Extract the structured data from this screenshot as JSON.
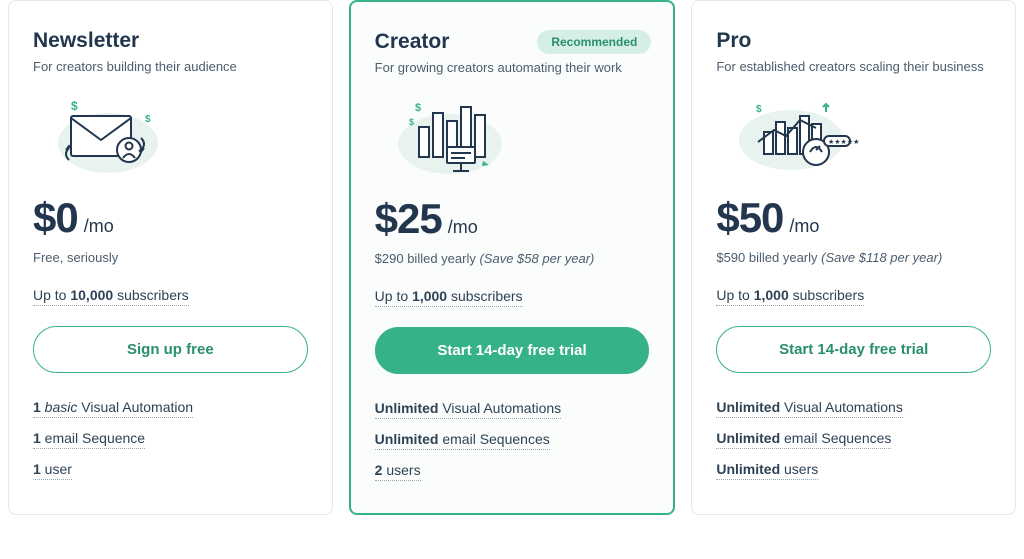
{
  "plans": [
    {
      "id": "newsletter",
      "title": "Newsletter",
      "subtitle": "For creators building their audience",
      "price": "$0",
      "per": "/mo",
      "price_note": "Free, seriously",
      "subscribers_prefix": "Up to ",
      "subscribers_count": "10,000",
      "subscribers_suffix": " subscribers",
      "cta": "Sign up free",
      "cta_style": "outline",
      "badge": "",
      "features": [
        {
          "bold": "1",
          "italic": " basic",
          "rest": " Visual Automation"
        },
        {
          "bold": "1",
          "italic": "",
          "rest": " email Sequence"
        },
        {
          "bold": "1",
          "italic": "",
          "rest": " user"
        }
      ]
    },
    {
      "id": "creator",
      "title": "Creator",
      "subtitle": "For growing creators automating their work",
      "price": "$25",
      "per": "/mo",
      "price_note": "$290 billed yearly ",
      "price_save": "(Save $58 per year)",
      "subscribers_prefix": "Up to ",
      "subscribers_count": "1,000",
      "subscribers_suffix": " subscribers",
      "cta": "Start 14-day free trial",
      "cta_style": "filled",
      "badge": "Recommended",
      "features": [
        {
          "bold": "Unlimited",
          "italic": "",
          "rest": " Visual Automations"
        },
        {
          "bold": "Unlimited",
          "italic": "",
          "rest": " email Sequences"
        },
        {
          "bold": "2",
          "italic": "",
          "rest": " users"
        }
      ]
    },
    {
      "id": "pro",
      "title": "Pro",
      "subtitle": "For established creators scaling their business",
      "price": "$50",
      "per": "/mo",
      "price_note": "$590 billed yearly ",
      "price_save": "(Save $118 per year)",
      "subscribers_prefix": "Up to ",
      "subscribers_count": "1,000",
      "subscribers_suffix": " subscribers",
      "cta": "Start 14-day free trial",
      "cta_style": "outline",
      "badge": "",
      "features": [
        {
          "bold": "Unlimited",
          "italic": "",
          "rest": " Visual Automations"
        },
        {
          "bold": "Unlimited",
          "italic": "",
          "rest": " email Sequences"
        },
        {
          "bold": "Unlimited",
          "italic": "",
          "rest": " users"
        }
      ]
    }
  ]
}
